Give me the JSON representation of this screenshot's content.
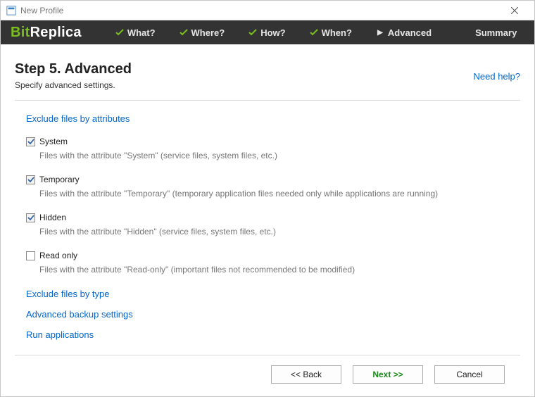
{
  "window": {
    "title": "New Profile"
  },
  "brand": {
    "part1": "Bit",
    "part2": "Replica"
  },
  "nav": {
    "what": "What?",
    "where": "Where?",
    "how": "How?",
    "when": "When?",
    "advanced": "Advanced",
    "summary": "Summary"
  },
  "header": {
    "title": "Step 5. Advanced",
    "subtitle": "Specify advanced settings.",
    "help": "Need help?"
  },
  "sections": {
    "exclude_attrs": "Exclude files by attributes",
    "exclude_type": "Exclude files by type",
    "adv_backup": "Advanced backup settings",
    "run_apps": "Run applications"
  },
  "attribs": {
    "system": {
      "label": "System",
      "checked": true,
      "desc": "Files with the attribute \"System\" (service files, system files, etc.)"
    },
    "temporary": {
      "label": "Temporary",
      "checked": true,
      "desc": "Files with the attribute \"Temporary\" (temporary application files needed only while applications are running)"
    },
    "hidden": {
      "label": "Hidden",
      "checked": true,
      "desc": "Files with the attribute \"Hidden\" (service files, system files, etc.)"
    },
    "readonly": {
      "label": "Read only",
      "checked": false,
      "desc": "Files with the attribute \"Read-only\" (important files not recommended to be modified)"
    }
  },
  "footer": {
    "back": "<< Back",
    "next": "Next >>",
    "cancel": "Cancel"
  }
}
